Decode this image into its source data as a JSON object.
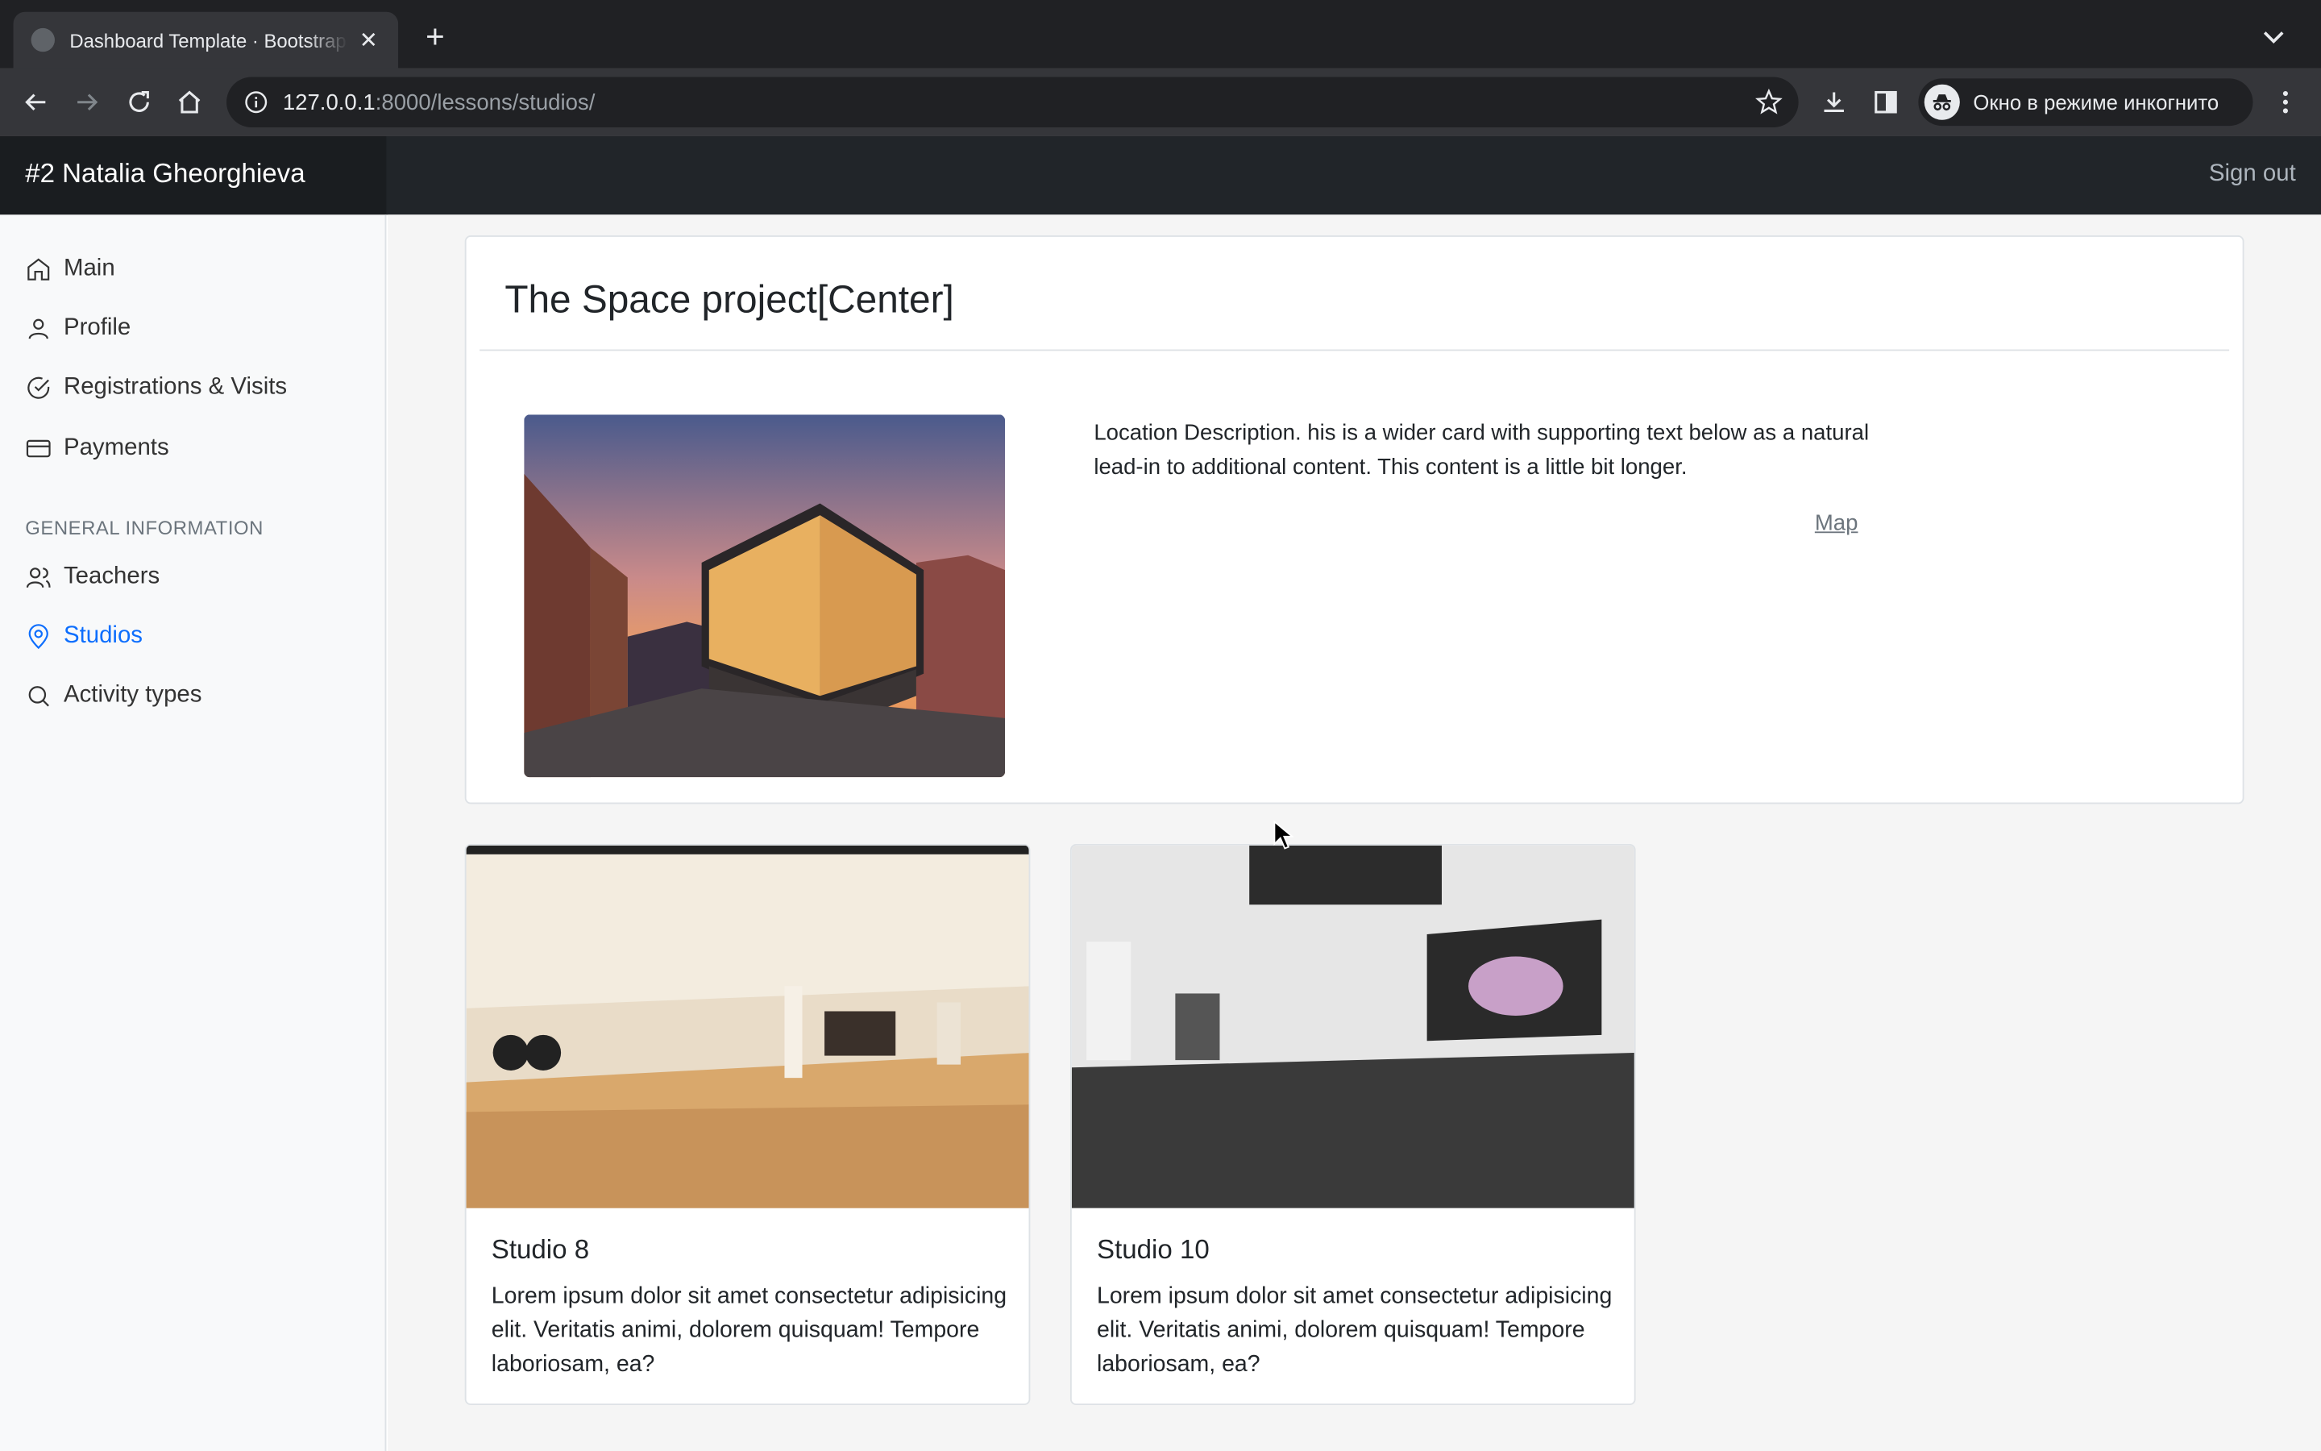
{
  "browser": {
    "tab_title": "Dashboard Template · Bootstrap",
    "url_host": "127.0.0.1",
    "url_rest": ":8000/lessons/studios/",
    "incognito_label": "Окно в режиме инкогнито"
  },
  "header": {
    "brand": "#2 Natalia Gheorghieva",
    "signout": "Sign out"
  },
  "sidebar": {
    "items": [
      {
        "label": "Main",
        "icon": "home-icon"
      },
      {
        "label": "Profile",
        "icon": "user-icon"
      },
      {
        "label": "Registrations & Visits",
        "icon": "check-circle-icon"
      },
      {
        "label": "Payments",
        "icon": "credit-card-icon"
      }
    ],
    "section_heading": "General information",
    "section_items": [
      {
        "label": "Teachers",
        "icon": "users-icon"
      },
      {
        "label": "Studios",
        "icon": "map-pin-icon",
        "active": true
      },
      {
        "label": "Activity types",
        "icon": "search-icon"
      }
    ],
    "accent_color": "#0d6efd"
  },
  "center": {
    "title": "The Space project[Center]",
    "description": "Location Description. his is a wider card with supporting text below as a natural lead-in to additional content. This content is a little bit longer.",
    "map_link": "Map"
  },
  "studios": [
    {
      "title": "Studio 8",
      "text": "Lorem ipsum dolor sit amet consectetur adipisicing elit. Veritatis animi, dolorem quisquam! Tempore laboriosam, ea?"
    },
    {
      "title": "Studio 10",
      "text": "Lorem ipsum dolor sit amet consectetur adipisicing elit. Veritatis animi, dolorem quisquam! Tempore laboriosam, ea?"
    }
  ]
}
